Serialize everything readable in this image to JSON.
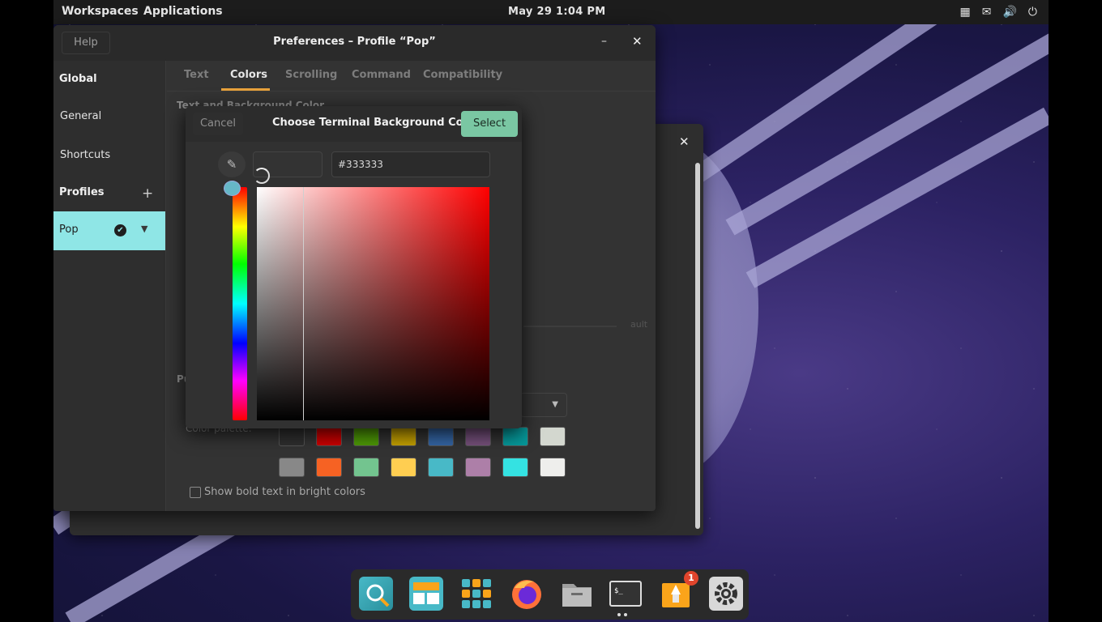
{
  "topbar": {
    "workspaces": "Workspaces",
    "applications": "Applications",
    "clock": "May 29   1:04 PM",
    "tray": [
      "▦",
      "✉",
      "🔊",
      "⏻"
    ]
  },
  "prefs": {
    "help": "Help",
    "title": "Preferences – Profile “Pop”",
    "minimize": "–",
    "close": "✕",
    "sidebar": {
      "global": "Global",
      "general": "General",
      "shortcuts": "Shortcuts",
      "profiles": "Profiles",
      "add": "+",
      "pop": "Pop",
      "check": "✔",
      "caret": "▼"
    },
    "tabs": [
      "Text",
      "Colors",
      "Scrolling",
      "Command",
      "Compatibility"
    ],
    "section_label": "Text and Background Color",
    "palette_section": "Pu",
    "palette_label": "Color palette:",
    "ghost_label": "ault",
    "dropdown_caret": "▼",
    "bold_checkbox": "Show bold text in bright colors",
    "palette_row1": [
      "#2f2f2f",
      "#cc0000",
      "#4e9a06",
      "#c4a000",
      "#3465a4",
      "#75507b",
      "#06989a",
      "#d3d7cf"
    ],
    "palette_row2": [
      "#888888",
      "#f66223",
      "#73c48f",
      "#ffce51",
      "#48b9c7",
      "#ad7fa8",
      "#34e2e2",
      "#eeeeec"
    ]
  },
  "backwin": {
    "close": "✕",
    "dot": "·"
  },
  "dialog": {
    "cancel": "Cancel",
    "title": "Choose Terminal Background Color",
    "select": "Select",
    "picker_icon": "✎",
    "hex_value": "#333333"
  },
  "colors": {
    "accent_cyan": "#8fe6e6",
    "tab_underline": "#e8a23c",
    "select_green": "#7ac7a3",
    "badge_red": "#e0452c"
  },
  "dock": {
    "badge": "1",
    "apps": [
      "pop-shop-search",
      "workspaces",
      "app-grid",
      "firefox",
      "files",
      "terminal",
      "installer",
      "settings"
    ]
  }
}
